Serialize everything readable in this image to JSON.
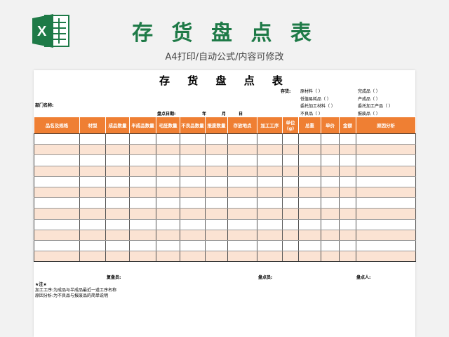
{
  "banner": {
    "title": "存 货 盘 点 表",
    "subtitle": "A4打印/自动公式/内容可修改",
    "logo_icon": "excel-icon",
    "title_color": "#1e7a47"
  },
  "sheet": {
    "title": "存 货 盘 点 表",
    "meta": {
      "stock_label": "存货:",
      "raw_material": "原材料（      ）",
      "finished": "完成品（      ）",
      "semi_finished": "低值易耗品（      ）",
      "product": "产成品（      ）",
      "process_material": "委托加工材料（      ）",
      "process_product": "委托加工产品（      ）",
      "defective": "不良品（      ）",
      "scrap": "报废品（      ）",
      "dept_label": "部门名称:",
      "date_label": "盘点日期:",
      "year": "年",
      "month": "月",
      "day": "日"
    },
    "table": {
      "header_color": "#ef7f33",
      "stripe_color": "#fbe3d3",
      "columns": [
        "品名及规格",
        "材型",
        "成品数量",
        "半成品数量",
        "毛胚数量",
        "不良品数量",
        "报废数量",
        "存放地点",
        "加工工序",
        "单位(g)",
        "总重",
        "单价",
        "金额",
        "原因分析"
      ],
      "row_count": 12
    },
    "footer": {
      "reviewer": "复盘员:",
      "counter": "盘点员:",
      "checker": "盘点人:",
      "note_title": "★注★",
      "note1": "加工工序:为成品与半成品最近一道工序名称",
      "note2": "原因分析:为不良品与报废品的简单说明"
    }
  }
}
